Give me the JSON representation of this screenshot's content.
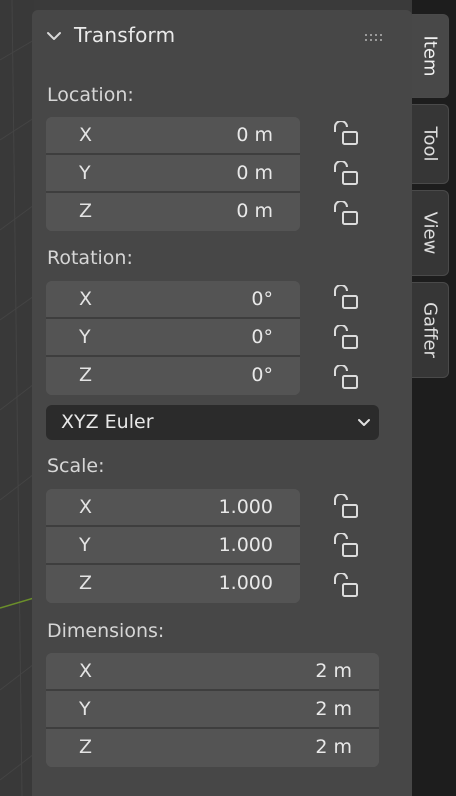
{
  "panel": {
    "title": "Transform"
  },
  "location": {
    "label": "Location:",
    "fields": [
      {
        "axis": "X",
        "value": "0 m"
      },
      {
        "axis": "Y",
        "value": "0 m"
      },
      {
        "axis": "Z",
        "value": "0 m"
      }
    ]
  },
  "rotation": {
    "label": "Rotation:",
    "fields": [
      {
        "axis": "X",
        "value": "0°"
      },
      {
        "axis": "Y",
        "value": "0°"
      },
      {
        "axis": "Z",
        "value": "0°"
      }
    ],
    "mode": "XYZ Euler"
  },
  "scale": {
    "label": "Scale:",
    "fields": [
      {
        "axis": "X",
        "value": "1.000"
      },
      {
        "axis": "Y",
        "value": "1.000"
      },
      {
        "axis": "Z",
        "value": "1.000"
      }
    ]
  },
  "dimensions": {
    "label": "Dimensions:",
    "fields": [
      {
        "axis": "X",
        "value": "2 m"
      },
      {
        "axis": "Y",
        "value": "2 m"
      },
      {
        "axis": "Z",
        "value": "2 m"
      }
    ]
  },
  "tabs": [
    {
      "label": "Item",
      "active": true
    },
    {
      "label": "Tool",
      "active": false
    },
    {
      "label": "View",
      "active": false
    },
    {
      "label": "Gaffer",
      "active": false
    }
  ],
  "icons": {
    "collapse": "chevron-down-icon",
    "grip": "grip-icon",
    "lock": "unlock-icon",
    "dropdown": "chevron-down-icon"
  },
  "colors": {
    "panel_bg": "#474747",
    "field_bg": "#545454",
    "dropdown_bg": "#2b2b2b",
    "tabbar_bg": "#1d1d1d",
    "grid_accent": "#6b8f2a"
  }
}
